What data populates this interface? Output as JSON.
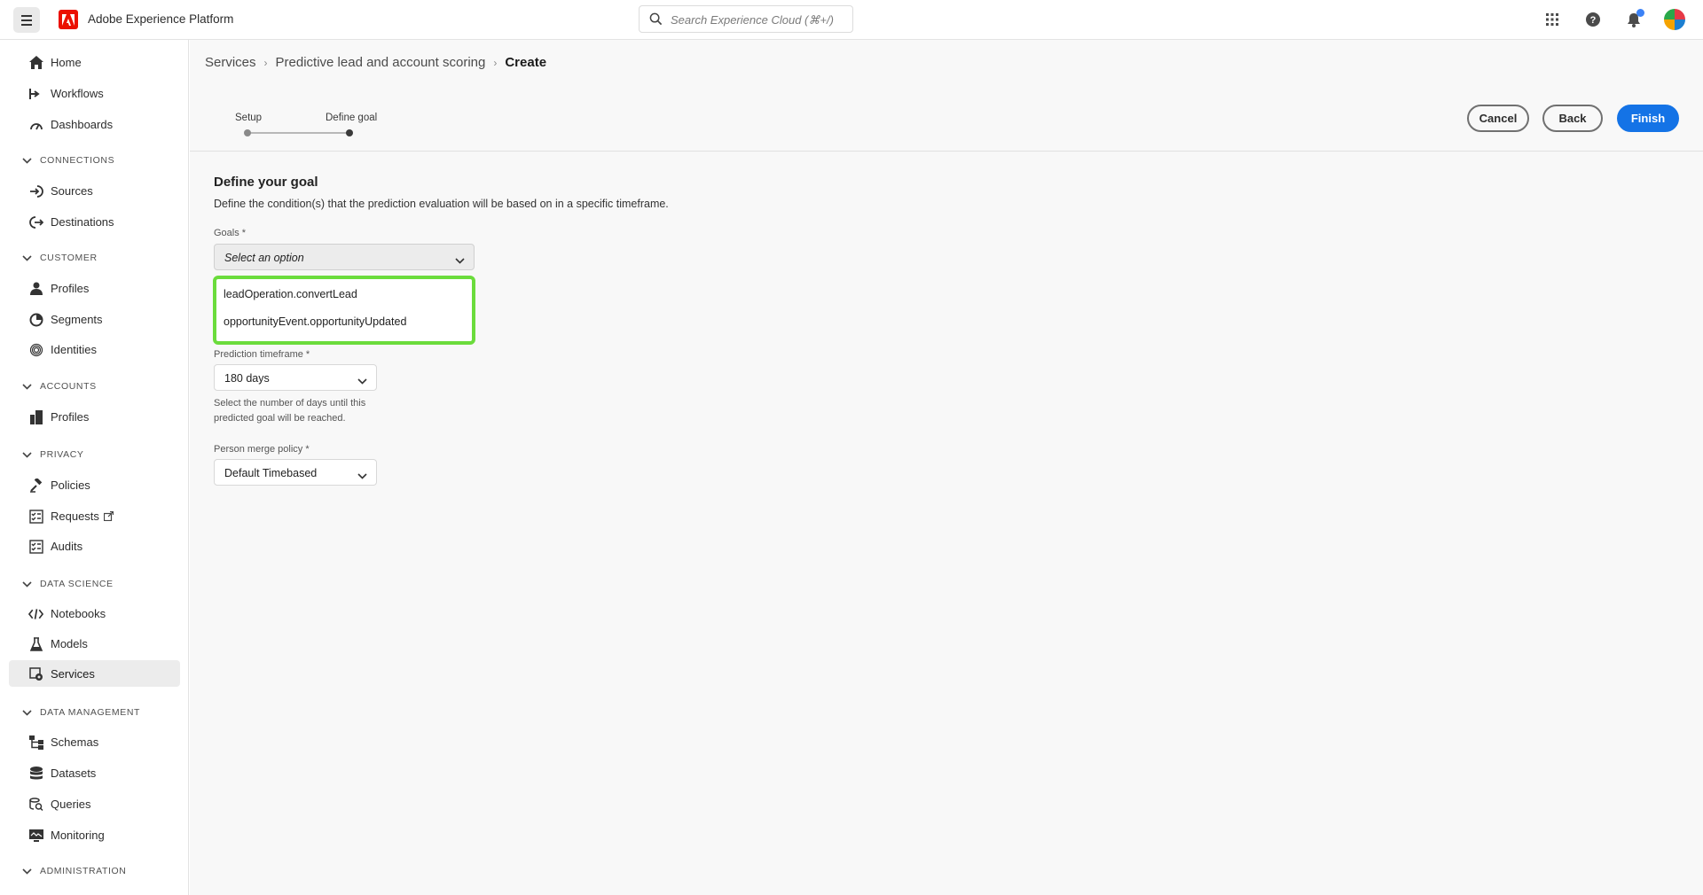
{
  "app": {
    "title": "Adobe Experience Platform"
  },
  "search": {
    "placeholder": "Search Experience Cloud (⌘+/)"
  },
  "sidebar": {
    "items": [
      {
        "label": "Home",
        "icon": "home-icon"
      },
      {
        "label": "Workflows",
        "icon": "workflow-icon"
      },
      {
        "label": "Dashboards",
        "icon": "dashboard-icon"
      }
    ],
    "sections": [
      {
        "label": "CONNECTIONS",
        "items": [
          {
            "label": "Sources"
          },
          {
            "label": "Destinations"
          }
        ]
      },
      {
        "label": "CUSTOMER",
        "items": [
          {
            "label": "Profiles"
          },
          {
            "label": "Segments"
          },
          {
            "label": "Identities"
          }
        ]
      },
      {
        "label": "ACCOUNTS",
        "items": [
          {
            "label": "Profiles"
          }
        ]
      },
      {
        "label": "PRIVACY",
        "items": [
          {
            "label": "Policies"
          },
          {
            "label": "Requests"
          },
          {
            "label": "Audits"
          }
        ]
      },
      {
        "label": "DATA SCIENCE",
        "items": [
          {
            "label": "Notebooks"
          },
          {
            "label": "Models"
          },
          {
            "label": "Services",
            "active": true
          }
        ]
      },
      {
        "label": "DATA MANAGEMENT",
        "items": [
          {
            "label": "Schemas"
          },
          {
            "label": "Datasets"
          },
          {
            "label": "Queries"
          },
          {
            "label": "Monitoring"
          }
        ]
      },
      {
        "label": "ADMINISTRATION",
        "items": []
      }
    ]
  },
  "breadcrumb": {
    "items": [
      "Services",
      "Predictive lead and account scoring"
    ],
    "current": "Create"
  },
  "steps": {
    "items": [
      "Setup",
      "Define goal"
    ],
    "active_index": 1
  },
  "actions": {
    "cancel": "Cancel",
    "back": "Back",
    "finish": "Finish"
  },
  "form": {
    "title": "Define your goal",
    "description": "Define the condition(s) that the prediction evaluation will be based on in a specific timeframe.",
    "goals": {
      "label": "Goals *",
      "placeholder": "Select an option",
      "options": [
        "leadOperation.convertLead",
        "opportunityEvent.opportunityUpdated"
      ]
    },
    "timeframe": {
      "label": "Prediction timeframe *",
      "value": "180 days",
      "help": "Select the number of days until this predicted goal will be reached."
    },
    "merge_policy": {
      "label": "Person merge policy *",
      "value": "Default Timebased"
    }
  },
  "colors": {
    "accent": "#1473e6",
    "highlight": "#6bdc3c",
    "brand": "#eb1000",
    "notification": "#3b82f6"
  }
}
